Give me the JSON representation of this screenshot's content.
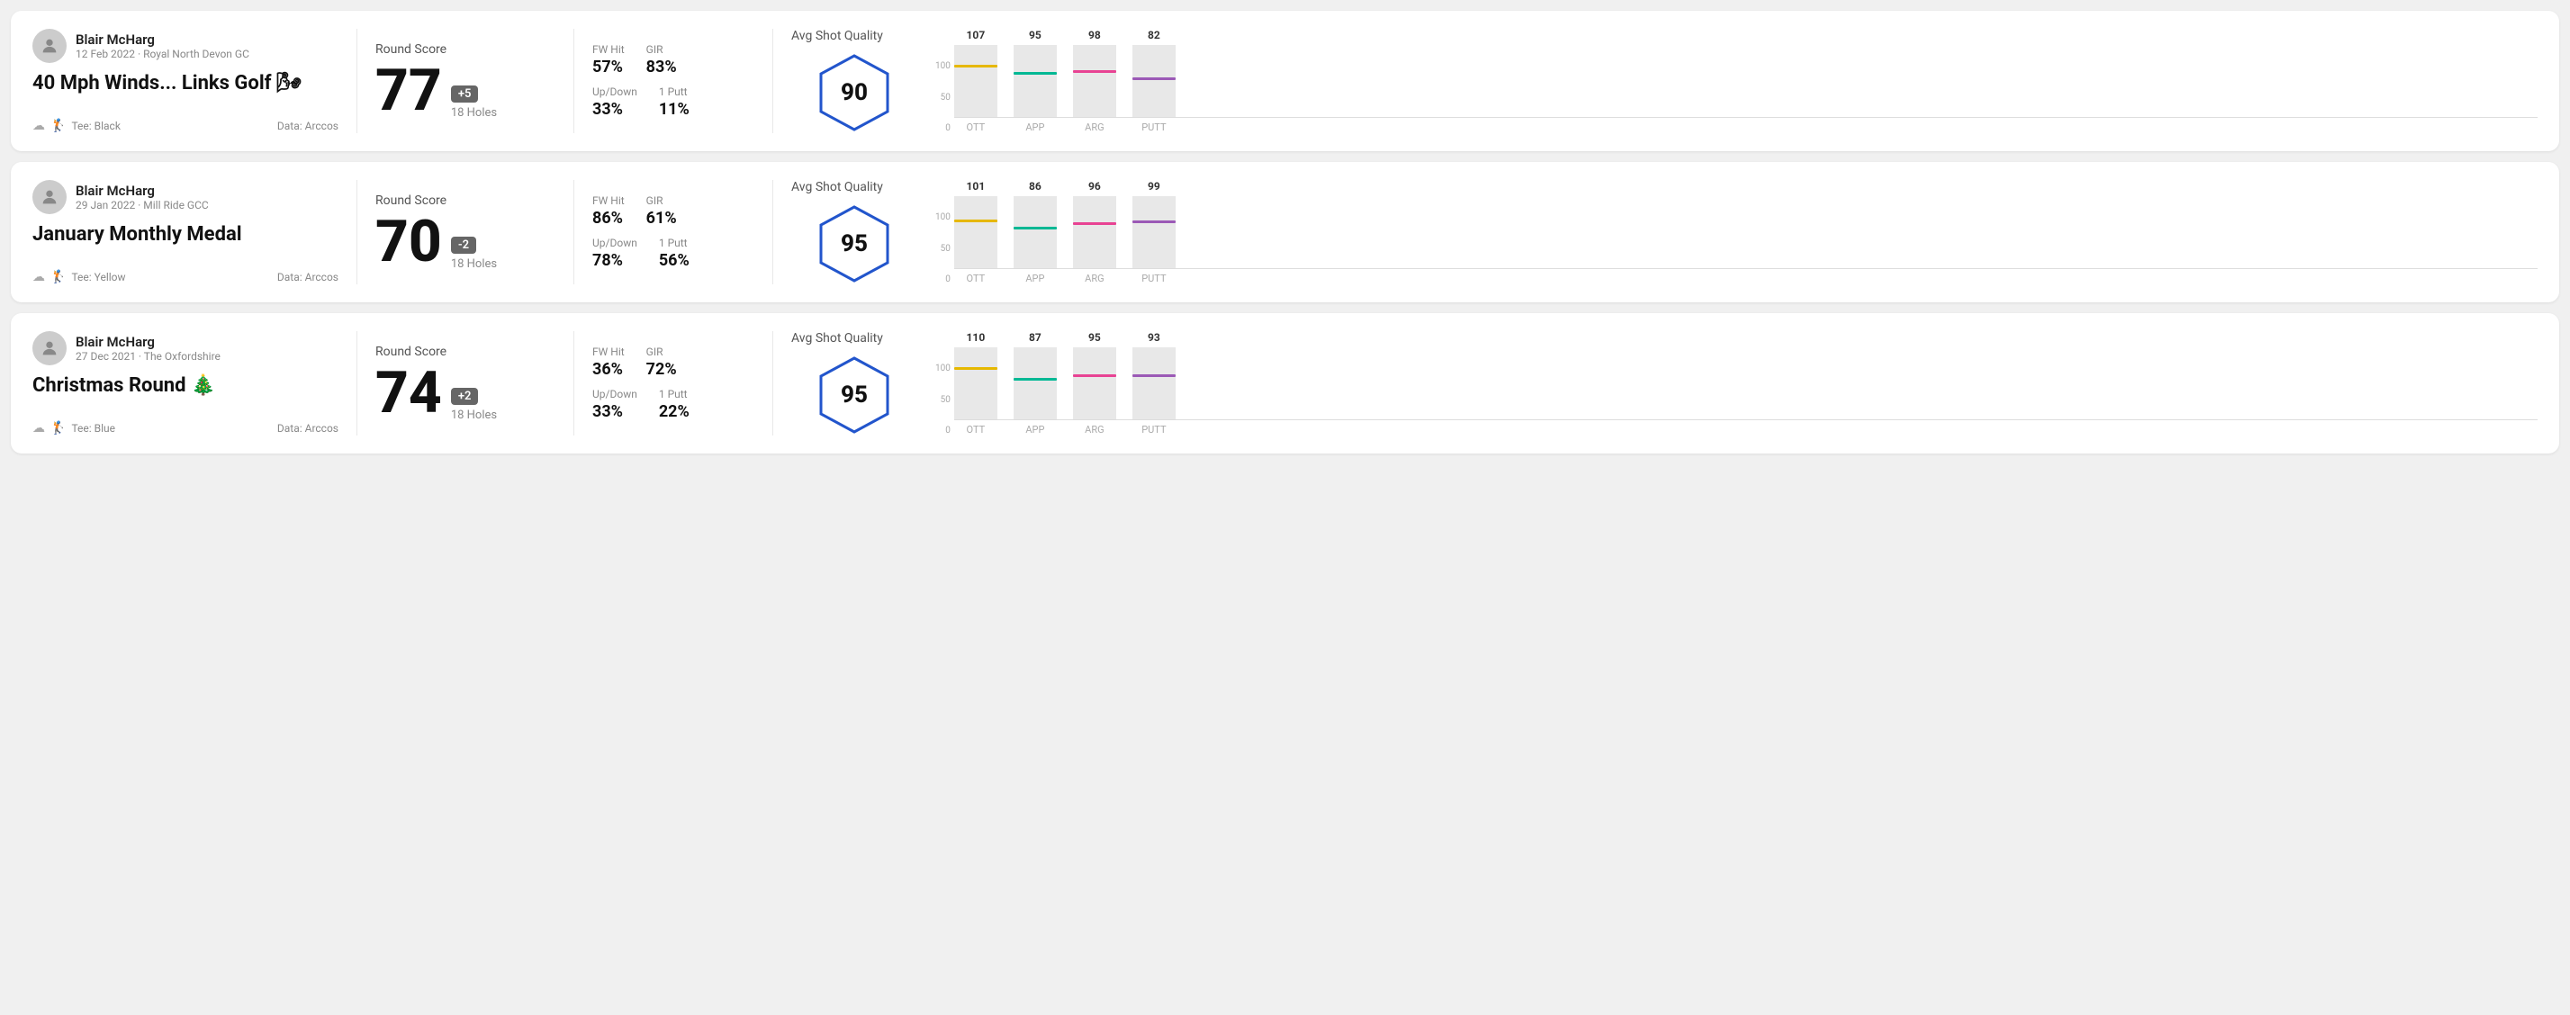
{
  "rounds": [
    {
      "id": "round-1",
      "user_name": "Blair McHarg",
      "user_meta": "12 Feb 2022 · Royal North Devon GC",
      "round_title": "40 Mph Winds... Links Golf 🌬",
      "tee": "Black",
      "data_source": "Data: Arccos",
      "score": "77",
      "score_diff": "+5",
      "score_diff_type": "over",
      "holes": "18 Holes",
      "fw_hit": "57%",
      "gir": "83%",
      "up_down": "33%",
      "one_putt": "11%",
      "avg_shot_quality": "90",
      "chart": {
        "ott": {
          "value": 107,
          "color": "#e6b800",
          "pct": 72
        },
        "app": {
          "value": 95,
          "color": "#00b894",
          "pct": 63
        },
        "arg": {
          "value": 98,
          "color": "#e84393",
          "pct": 65
        },
        "putt": {
          "value": 82,
          "color": "#9b59b6",
          "pct": 55
        }
      }
    },
    {
      "id": "round-2",
      "user_name": "Blair McHarg",
      "user_meta": "29 Jan 2022 · Mill Ride GCC",
      "round_title": "January Monthly Medal",
      "tee": "Yellow",
      "data_source": "Data: Arccos",
      "score": "70",
      "score_diff": "-2",
      "score_diff_type": "under",
      "holes": "18 Holes",
      "fw_hit": "86%",
      "gir": "61%",
      "up_down": "78%",
      "one_putt": "56%",
      "avg_shot_quality": "95",
      "chart": {
        "ott": {
          "value": 101,
          "color": "#e6b800",
          "pct": 67
        },
        "app": {
          "value": 86,
          "color": "#00b894",
          "pct": 57
        },
        "arg": {
          "value": 96,
          "color": "#e84393",
          "pct": 64
        },
        "putt": {
          "value": 99,
          "color": "#9b59b6",
          "pct": 66
        }
      }
    },
    {
      "id": "round-3",
      "user_name": "Blair McHarg",
      "user_meta": "27 Dec 2021 · The Oxfordshire",
      "round_title": "Christmas Round 🎄",
      "tee": "Blue",
      "data_source": "Data: Arccos",
      "score": "74",
      "score_diff": "+2",
      "score_diff_type": "over",
      "holes": "18 Holes",
      "fw_hit": "36%",
      "gir": "72%",
      "up_down": "33%",
      "one_putt": "22%",
      "avg_shot_quality": "95",
      "chart": {
        "ott": {
          "value": 110,
          "color": "#e6b800",
          "pct": 73
        },
        "app": {
          "value": 87,
          "color": "#00b894",
          "pct": 58
        },
        "arg": {
          "value": 95,
          "color": "#e84393",
          "pct": 63
        },
        "putt": {
          "value": 93,
          "color": "#9b59b6",
          "pct": 62
        }
      }
    }
  ],
  "chart_labels": {
    "ott": "OTT",
    "app": "APP",
    "arg": "ARG",
    "putt": "PUTT"
  },
  "y_axis_labels": [
    "100",
    "50",
    "0"
  ]
}
